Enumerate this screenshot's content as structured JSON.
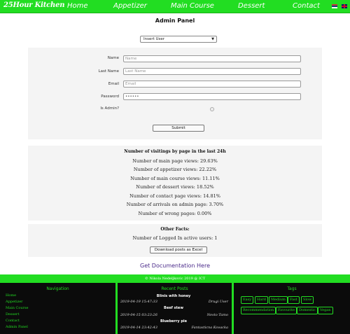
{
  "nav": {
    "brand": "25Hour Kitchen",
    "items": [
      "Home",
      "Appetizer",
      "Main Course",
      "Dessert",
      "Contact"
    ],
    "flags": [
      "serbian-flag-icon",
      "uk-flag-icon"
    ]
  },
  "page": {
    "title": "Admin Panel"
  },
  "action_select": {
    "value": "Insert User"
  },
  "form": {
    "name_label": "Name",
    "name_placeholder": "Name",
    "lastname_label": "Last Name",
    "lastname_placeholder": "Last Name",
    "email_label": "Email",
    "email_placeholder": "Email",
    "password_label": "Password",
    "password_value": "••••••",
    "is_admin_label": "Is Admin?",
    "submit_label": "Submit"
  },
  "stats": {
    "title": "Number of visitings by page in the last 24h",
    "lines": [
      "Number of main page views: 29.63%",
      "Number of appetizer views: 22.22%",
      "Number of main course views: 11.11%",
      "Number of dessert views: 18.52%",
      "Number of contact page views: 14.81%",
      "Number of arrivals on admin page: 3.70%",
      "Number of wrong pages: 0.00%"
    ]
  },
  "facts": {
    "title": "Other Facts:",
    "logged_in": "Number of Logged In active users: 1",
    "export_label": "Download posts as Excel"
  },
  "doc_link": "Get Documentation Here",
  "copyright": "© Nikola Nedeljkovic 2019    @ ICT",
  "footer": {
    "navigation_title": "Navigation",
    "navigation_links": [
      "Home",
      "Appetizer",
      "Main Course",
      "Dessert",
      "Contact",
      "Admin Panel"
    ],
    "recent_title": "Recent Posts",
    "recent_posts": [
      {
        "title": "Blinis with honey",
        "date": "2019-04-19 15:47:33",
        "author": "Drugi User"
      },
      {
        "title": "Beef stew",
        "date": "2019-04-15 03:23:26",
        "author": "Nesto Tamo"
      },
      {
        "title": "Blueberry pie",
        "date": "2019-04-14 23:42:43",
        "author": "Fantasticna Kovacka"
      }
    ],
    "tags_title": "Tags",
    "tags": [
      "Easy",
      "Hard",
      "Medium",
      "Fast",
      "Slow",
      "Recommendation",
      "Favourite",
      "Domestic",
      "Vegan"
    ]
  },
  "colors": {
    "accent": "#22dd22",
    "footer_bg": "#0b0b0b",
    "panel_bg": "#f4f4f4",
    "link": "#4a2a8a"
  }
}
